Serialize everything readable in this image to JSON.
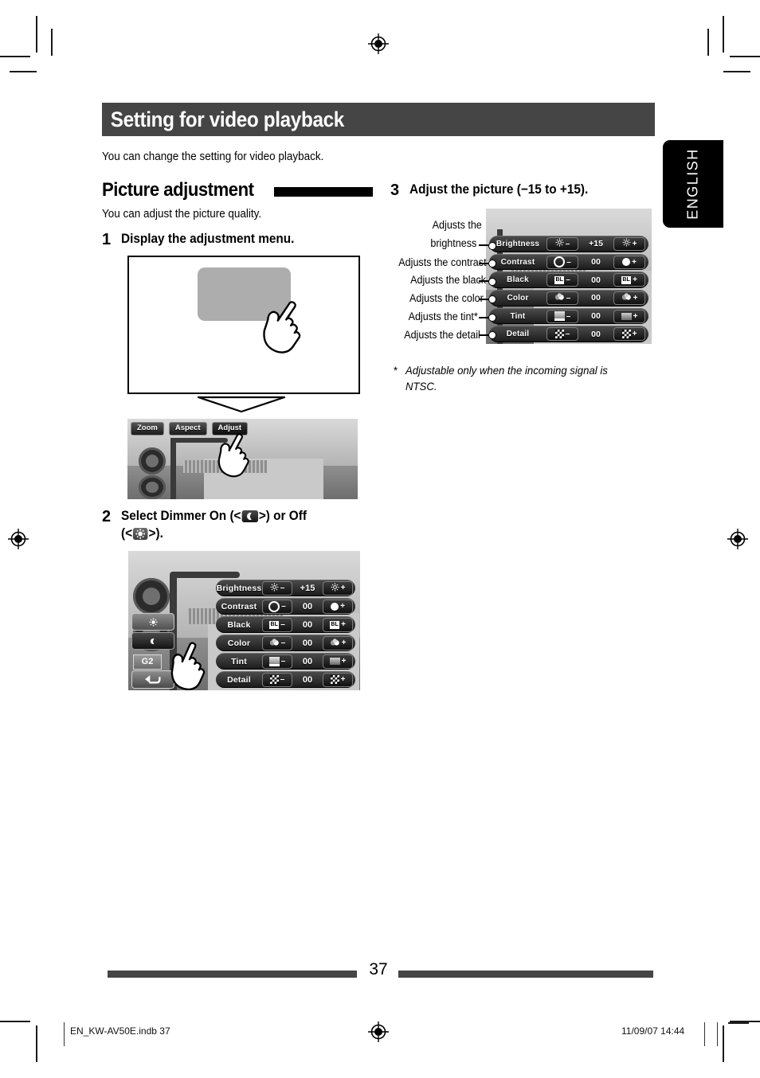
{
  "document": {
    "header_title": "Setting for video playback",
    "intro": "You can change the setting for video playback.",
    "language_tab": "ENGLISH",
    "page_number": "37",
    "footer_left": "EN_KW-AV50E.indb   37",
    "footer_right": "11/09/07   14:44"
  },
  "section": {
    "heading": "Picture adjustment",
    "subtitle": "You can adjust the picture quality."
  },
  "steps": [
    {
      "num": "1",
      "lines": [
        "Display the adjustment menu."
      ]
    },
    {
      "num": "2",
      "lines": [
        "Select Dimmer On (<",
        ">) or Off",
        "(<",
        ">)."
      ]
    },
    {
      "num": "3",
      "lines": [
        "Adjust the picture (−15 to +15)."
      ]
    }
  ],
  "step2_text": {
    "line1_a": "Select Dimmer On (<",
    "line1_b": ">) or Off",
    "line2_a": "(<",
    "line2_b": ">)."
  },
  "step3_text": "Adjust the picture (−15 to +15).",
  "step1_text": "Display the adjustment menu.",
  "onscreen_buttons": {
    "zoom": "Zoom",
    "aspect": "Aspect",
    "adjust": "Adjust"
  },
  "device_labels": {
    "guidance_id": "G2",
    "black_icon_text": "BL"
  },
  "adjust_menu": {
    "rows": [
      {
        "label": "Brightness",
        "value": "+15",
        "minus_icon": "sun-icon",
        "plus_icon": "sun-icon"
      },
      {
        "label": "Contrast",
        "value": "00",
        "minus_icon": "ring-icon",
        "plus_icon": "disc-icon"
      },
      {
        "label": "Black",
        "value": "00",
        "minus_icon": "black-level-icon",
        "plus_icon": "black-level-icon"
      },
      {
        "label": "Color",
        "value": "00",
        "minus_icon": "color-icon",
        "plus_icon": "color-icon"
      },
      {
        "label": "Tint",
        "value": "00",
        "minus_icon": "tint-icon",
        "plus_icon": "tint-icon"
      },
      {
        "label": "Detail",
        "value": "00",
        "minus_icon": "detail-icon",
        "plus_icon": "detail-icon"
      }
    ],
    "minus_sign": "–",
    "plus_sign": "+"
  },
  "callouts": [
    {
      "line1": "Adjusts the",
      "line2": "brightness"
    },
    {
      "line1": "Adjusts the contrast",
      "line2": ""
    },
    {
      "line1": "Adjusts the black",
      "line2": ""
    },
    {
      "line1": "Adjusts the color",
      "line2": ""
    },
    {
      "line1": "Adjusts the tint*",
      "line2": ""
    },
    {
      "line1": "Adjusts the detail",
      "line2": ""
    }
  ],
  "footnote": {
    "marker": "*",
    "text": "Adjustable only when the incoming signal is NTSC."
  },
  "colors": {
    "header_band": "#454545",
    "rule": "#000000",
    "tab": "#000000",
    "menu_row": "#2b2b2b"
  }
}
